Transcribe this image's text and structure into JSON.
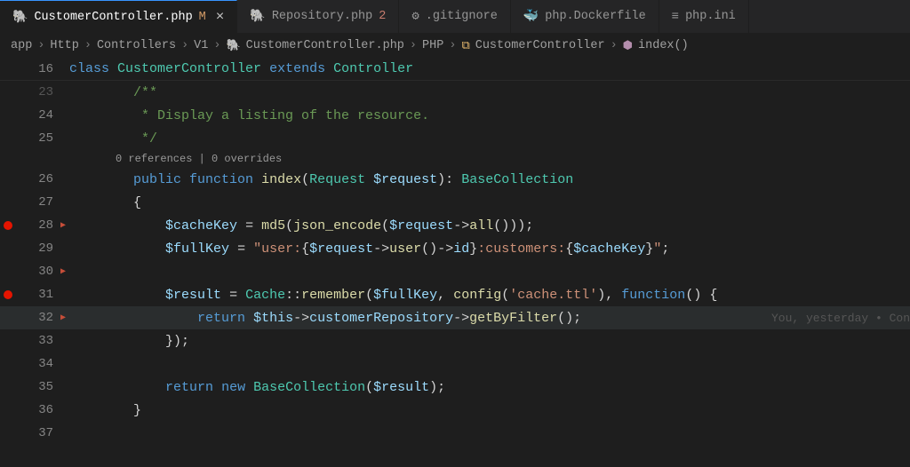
{
  "tabs": [
    {
      "icon": "elephant",
      "label": "CustomerController.php",
      "badge": "M",
      "active": true,
      "closeVisible": true
    },
    {
      "icon": "elephant",
      "label": "Repository.php",
      "badge": "2",
      "active": false
    },
    {
      "icon": "gear",
      "label": ".gitignore",
      "active": false
    },
    {
      "icon": "whale",
      "label": "php.Dockerfile",
      "active": false
    },
    {
      "icon": "ini",
      "label": "php.ini",
      "active": false
    }
  ],
  "breadcrumb": {
    "parts": [
      "app",
      "Http",
      "Controllers",
      "V1"
    ],
    "file": "CustomerController.php",
    "lang": "PHP",
    "class": "CustomerController",
    "method": "index()"
  },
  "sticky": {
    "num": "16",
    "code_html": "<span class='kw'>class</span> <span class='cls'>CustomerController</span> <span class='kw'>extends</span> <span class='cls'>Controller</span>"
  },
  "codelens": "0 references | 0 overrides",
  "inline_blame": "You, yesterday • Con",
  "lines": [
    {
      "num": "23",
      "dim": true,
      "fold": false,
      "bp": false,
      "html": "        <span class='cmt'>/**</span>"
    },
    {
      "num": "24",
      "dim": false,
      "fold": false,
      "bp": false,
      "html": "         <span class='cmt'>* Display a listing of the resource.</span>"
    },
    {
      "num": "25",
      "dim": false,
      "fold": false,
      "bp": false,
      "html": "         <span class='cmt'>*/</span>"
    },
    {
      "num": "26",
      "dim": false,
      "fold": false,
      "bp": false,
      "html": "        <span class='kw'>public</span> <span class='kw'>function</span> <span class='fn'>index</span><span class='pun'>(</span><span class='cls'>Request</span> <span class='var'>$request</span><span class='pun'>)</span><span class='pun'>:</span> <span class='cls'>BaseCollection</span>"
    },
    {
      "num": "27",
      "dim": false,
      "fold": false,
      "bp": false,
      "html": "        <span class='pun'>{</span>"
    },
    {
      "num": "28",
      "dim": false,
      "fold": true,
      "bp": true,
      "html": "            <span class='var'>$cacheKey</span> <span class='op'>=</span> <span class='fn'>md5</span><span class='pun'>(</span><span class='fn'>json_encode</span><span class='pun'>(</span><span class='var'>$request</span><span class='op'>-></span><span class='fn'>all</span><span class='pun'>()));</span>"
    },
    {
      "num": "29",
      "dim": false,
      "fold": false,
      "bp": false,
      "html": "            <span class='var'>$fullKey</span> <span class='op'>=</span> <span class='str'>\"user:</span><span class='pun'>{</span><span class='var'>$request</span><span class='op'>-></span><span class='fn'>user</span><span class='pun'>()</span><span class='op'>-></span><span class='var'>id</span><span class='pun'>}</span><span class='str'>:customers:</span><span class='pun'>{</span><span class='var'>$cacheKey</span><span class='pun'>}</span><span class='str'>\"</span><span class='pun'>;</span>"
    },
    {
      "num": "30",
      "dim": false,
      "fold": true,
      "bp": false,
      "html": ""
    },
    {
      "num": "31",
      "dim": false,
      "fold": false,
      "bp": true,
      "html": "            <span class='var'>$result</span> <span class='op'>=</span> <span class='cls'>Cache</span><span class='op'>::</span><span class='fn'>remember</span><span class='pun'>(</span><span class='var'>$fullKey</span><span class='pun'>,</span> <span class='fn'>config</span><span class='pun'>(</span><span class='str'>'cache.ttl'</span><span class='pun'>),</span> <span class='kw'>function</span><span class='pun'>() {</span>"
    },
    {
      "num": "32",
      "dim": false,
      "fold": true,
      "bp": false,
      "current": true,
      "blame": true,
      "html": "                <span class='kw'>return</span> <span class='var'>$this</span><span class='op'>-></span><span class='var'>customerRepository</span><span class='op'>-></span><span class='fn'>getByFilter</span><span class='pun'>();</span>"
    },
    {
      "num": "33",
      "dim": false,
      "fold": false,
      "bp": false,
      "html": "            <span class='pun'>});</span>"
    },
    {
      "num": "34",
      "dim": false,
      "fold": false,
      "bp": false,
      "html": ""
    },
    {
      "num": "35",
      "dim": false,
      "fold": false,
      "bp": false,
      "html": "            <span class='kw'>return</span> <span class='kw'>new</span> <span class='cls'>BaseCollection</span><span class='pun'>(</span><span class='var'>$result</span><span class='pun'>);</span>"
    },
    {
      "num": "36",
      "dim": false,
      "fold": false,
      "bp": false,
      "html": "        <span class='pun'>}</span>"
    },
    {
      "num": "37",
      "dim": false,
      "fold": false,
      "bp": false,
      "html": ""
    }
  ]
}
